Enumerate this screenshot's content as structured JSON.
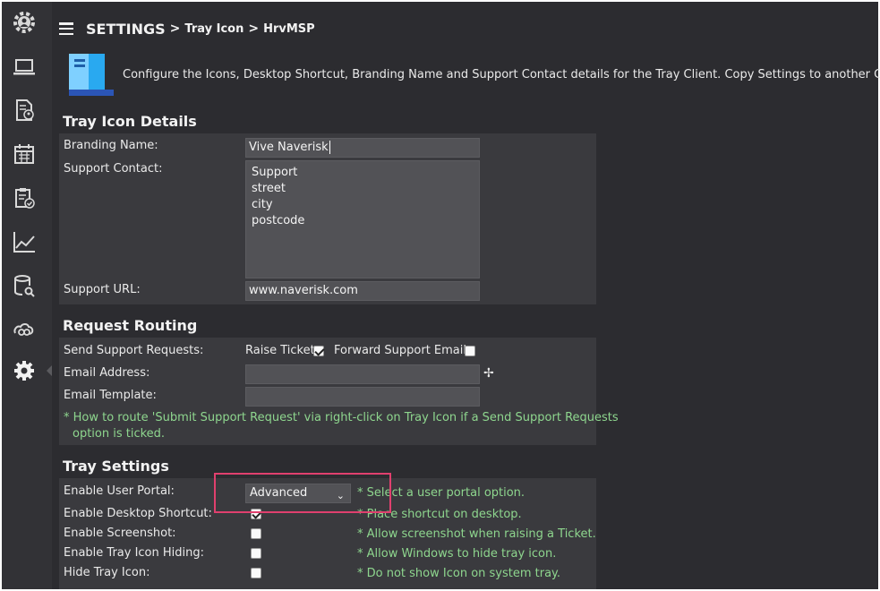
{
  "sidebar": {
    "items": [
      {
        "icon": "settings-person-icon"
      },
      {
        "icon": "laptop-icon"
      },
      {
        "icon": "document-user-icon"
      },
      {
        "icon": "calendar-icon"
      },
      {
        "icon": "clipboard-check-icon"
      },
      {
        "icon": "chart-line-icon"
      },
      {
        "icon": "database-search-icon"
      },
      {
        "icon": "cloud-link-icon"
      },
      {
        "icon": "gear-icon"
      }
    ]
  },
  "header": {
    "title": "SETTINGS",
    "crumb1": "Tray Icon",
    "crumb2": "HrvMSP"
  },
  "intro": {
    "text": "Configure the Icons, Desktop Shortcut, Branding Name and Support Contact details for the Tray Client. Copy Settings to another Client."
  },
  "tray_icon_details": {
    "title": "Tray Icon Details",
    "branding_label": "Branding Name:",
    "branding_value": "Vive Naverisk",
    "support_contact_label": "Support Contact:",
    "support_contact_lines": [
      "Support",
      "street",
      "city",
      "postcode"
    ],
    "support_url_label": "Support URL:",
    "support_url_value": "www.naverisk.com"
  },
  "request_routing": {
    "title": "Request Routing",
    "send_label": "Send Support Requests:",
    "raise_ticket_label": "Raise Ticket",
    "raise_ticket_checked": true,
    "forward_email_label": "Forward Support Email",
    "forward_email_checked": false,
    "email_address_label": "Email Address:",
    "email_address_value": "",
    "email_template_label": "Email Template:",
    "email_template_value": "",
    "note_line1": "* How to route 'Submit Support Request' via right-click on Tray Icon if a Send Support Requests",
    "note_line2": "option is ticked."
  },
  "tray_settings": {
    "title": "Tray Settings",
    "user_portal_label": "Enable User Portal:",
    "user_portal_value": "Advanced",
    "user_portal_hint": "* Select a user portal option.",
    "desktop_shortcut_label": "Enable Desktop Shortcut:",
    "desktop_shortcut_checked": true,
    "desktop_shortcut_hint": "* Place shortcut on desktop.",
    "screenshot_label": "Enable Screenshot:",
    "screenshot_checked": false,
    "screenshot_hint": "* Allow screenshot when raising a Ticket.",
    "tray_hiding_label": "Enable Tray Icon Hiding:",
    "tray_hiding_checked": false,
    "tray_hiding_hint": "* Allow Windows to hide tray icon.",
    "hide_tray_label": "Hide Tray Icon:",
    "hide_tray_checked": false,
    "hide_tray_hint": "* Do not show Icon on system tray."
  },
  "colors": {
    "background": "#2c2c30",
    "panel": "#3a3a3e",
    "hint_green": "#8ed68e",
    "highlight": "#e0406e"
  }
}
